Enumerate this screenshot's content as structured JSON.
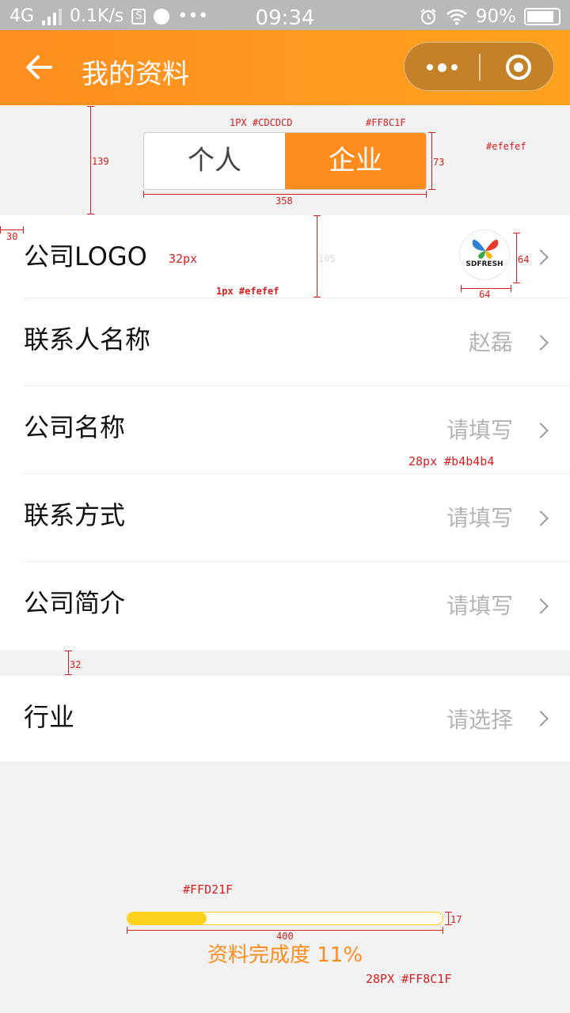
{
  "status_bar": {
    "network": "4G",
    "speed": "0.1K/s",
    "time": "09:34",
    "battery": "90%"
  },
  "nav": {
    "title": "我的资料"
  },
  "tabs": [
    {
      "label": "个人",
      "active": false
    },
    {
      "label": "企业",
      "active": true
    }
  ],
  "items": {
    "logo": {
      "label": "公司LOGO",
      "logo_text": "SDFRESH"
    },
    "contact_name": {
      "label": "联系人名称",
      "value": "赵磊"
    },
    "company_name": {
      "label": "公司名称",
      "value": "请填写"
    },
    "contact": {
      "label": "联系方式",
      "value": "请填写"
    },
    "intro": {
      "label": "公司简介",
      "value": "请填写"
    },
    "industry": {
      "label": "行业",
      "value": "请选择"
    }
  },
  "progress": {
    "text": "资料完成度 11%",
    "fraction": 0.25
  },
  "annotations": {
    "seg_border": "1PX #CDCDCD",
    "seg_color": "#FF8C1F",
    "bg_color": "#efefef",
    "h139": "139",
    "h73": "73",
    "w358": "358",
    "w30": "30",
    "font32": "32px",
    "h105": "105",
    "divider": "1px  #efefef",
    "logo_h": "64",
    "logo_w": "64",
    "value_style": "28px #b4b4b4",
    "gap32": "32",
    "bar_color": "#FFD21F",
    "bar_w": "400",
    "bar_h": "17",
    "text_style": "28PX #FF8C1F"
  },
  "colors": {
    "accent": "#FF8C1F",
    "progress": "#FFD21F",
    "placeholder": "#b4b4b4",
    "divider": "#efefef",
    "segment_border": "#CDCDCD"
  }
}
